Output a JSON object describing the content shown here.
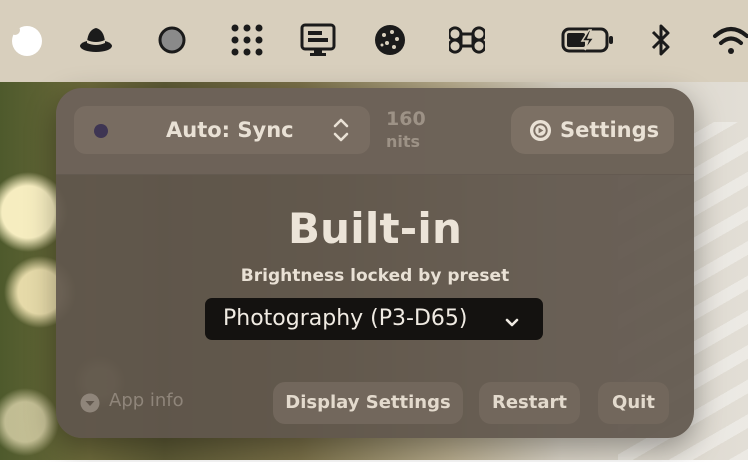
{
  "menubar": {
    "icons": [
      "app-circle-icon",
      "hat-icon",
      "circle-outline-icon",
      "dot-grid-icon",
      "monitor-icon",
      "cookie-icon",
      "command-icon",
      "battery-charging-icon",
      "bluetooth-icon",
      "wifi-icon"
    ]
  },
  "panel": {
    "mode_selector": {
      "label": "Auto: Sync"
    },
    "nits": {
      "value": "160",
      "unit": "nits"
    },
    "settings_label": "Settings",
    "display_name": "Built-in",
    "status": "Brightness locked by preset",
    "preset": {
      "label": "Photography (P3-D65)"
    },
    "footer": {
      "app_info": "App info",
      "display_settings": "Display Settings",
      "restart": "Restart",
      "quit": "Quit"
    }
  },
  "colors": {
    "panel_bg": "#60564c",
    "preset_bg": "#141210",
    "text": "#e9e1d5",
    "dim_text": "#9d9286",
    "dot": "#3e3553"
  }
}
